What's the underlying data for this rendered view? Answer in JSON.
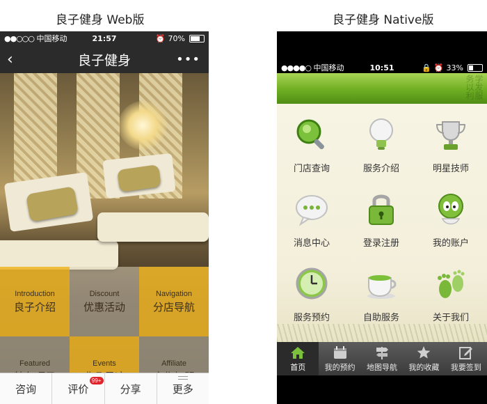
{
  "captions": {
    "left": "良子健身   Web版",
    "right": "良子健身   Native版"
  },
  "web": {
    "status": {
      "carrier": "中国移动",
      "time": "21:57",
      "battery": "70%",
      "battery_level": 0.7
    },
    "nav": {
      "back": "‹",
      "title": "良子健身",
      "more": "•••"
    },
    "tiles": [
      {
        "en": "Introduction",
        "zh": "良子介绍"
      },
      {
        "en": "Discount",
        "zh": "优惠活动"
      },
      {
        "en": "Navigation",
        "zh": "分店导航"
      },
      {
        "en": "Featured",
        "zh": "特色项目"
      },
      {
        "en": "Events",
        "zh": "非凡足迹"
      },
      {
        "en": "Affiliate",
        "zh": "合作加盟"
      }
    ],
    "menu": [
      {
        "label": "咨询"
      },
      {
        "label": "评价",
        "badge": "99+"
      },
      {
        "label": "分享"
      },
      {
        "label": "更多"
      }
    ],
    "colors": {
      "gold": "#eeb528",
      "navbar": "#2b2b2b"
    }
  },
  "native": {
    "status": {
      "carrier": "中国移动",
      "time": "10:51",
      "battery": "33%",
      "battery_level": 0.33
    },
    "calligraphy": "学发服务以利",
    "icons": [
      {
        "label": "门店查询",
        "icon": "magnifier-icon"
      },
      {
        "label": "服务介绍",
        "icon": "lightbulb-icon"
      },
      {
        "label": "明星技师",
        "icon": "trophy-icon"
      },
      {
        "label": "消息中心",
        "icon": "chat-bubble-icon"
      },
      {
        "label": "登录注册",
        "icon": "padlock-icon"
      },
      {
        "label": "我的账户",
        "icon": "avatar-icon"
      },
      {
        "label": "服务预约",
        "icon": "clock-icon"
      },
      {
        "label": "自助服务",
        "icon": "teacup-icon"
      },
      {
        "label": "关于我们",
        "icon": "footprints-icon"
      }
    ],
    "tabs": [
      {
        "label": "首页",
        "icon": "home-icon"
      },
      {
        "label": "我的预约",
        "icon": "calendar-icon"
      },
      {
        "label": "地图导航",
        "icon": "signpost-icon"
      },
      {
        "label": "我的收藏",
        "icon": "star-icon"
      },
      {
        "label": "我要签到",
        "icon": "edit-icon"
      }
    ],
    "colors": {
      "green": "#6fae23",
      "tabbar": "#3a3a3a"
    }
  }
}
